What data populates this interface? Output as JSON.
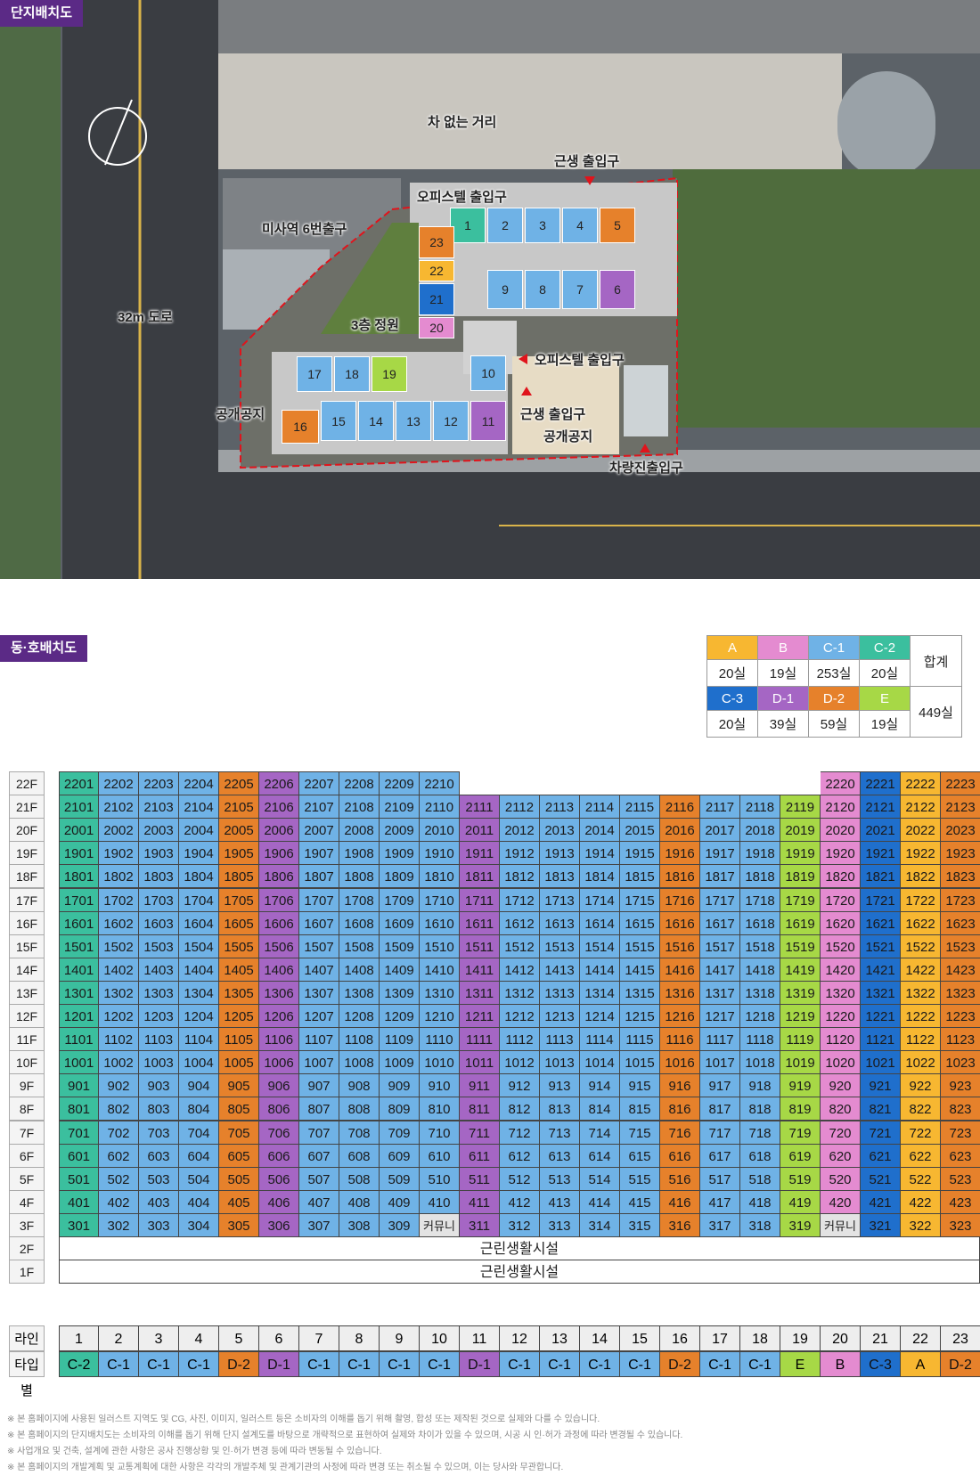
{
  "section1_title": "단지배치도",
  "section2_title": "동·호배치도",
  "map": {
    "street_no_cars": "차 없는 거리",
    "retail_entrance_top": "근생 출입구",
    "officetel_entrance_top": "오피스텔 출입구",
    "misa_exit": "미사역 6번출구",
    "road_32m": "32m 도로",
    "garden_3f": "3층 정원",
    "officetel_entrance_right": "오피스텔 출입구",
    "public_space_left": "공개공지",
    "retail_entrance_bottom": "근생 출입구",
    "public_space_right": "공개공지",
    "vehicle_entrance": "차량진출입구",
    "units": [
      "1",
      "2",
      "3",
      "4",
      "5",
      "6",
      "7",
      "8",
      "9",
      "10",
      "11",
      "12",
      "13",
      "14",
      "15",
      "16",
      "17",
      "18",
      "19",
      "20",
      "21",
      "22",
      "23"
    ]
  },
  "colors": {
    "A": "#f7b731",
    "B": "#e48bd0",
    "C-1": "#6fb2e6",
    "C-2": "#3bbf9e",
    "C-3": "#1f6fcc",
    "D-1": "#a566c4",
    "D-2": "#e6812b",
    "E": "#a7d846"
  },
  "type_stats": {
    "row1_types": [
      "A",
      "B",
      "C-1",
      "C-2"
    ],
    "row1_counts": [
      "20실",
      "19실",
      "253실",
      "20실"
    ],
    "row2_types": [
      "C-3",
      "D-1",
      "D-2",
      "E"
    ],
    "row2_counts": [
      "20실",
      "39실",
      "59실",
      "19실"
    ],
    "total_label": "합계",
    "total_value": "449실"
  },
  "line_types": [
    "C-2",
    "C-1",
    "C-1",
    "C-1",
    "D-2",
    "D-1",
    "C-1",
    "C-1",
    "C-1",
    "C-1",
    "D-1",
    "C-1",
    "C-1",
    "C-1",
    "C-1",
    "D-2",
    "C-1",
    "C-1",
    "E",
    "B",
    "C-3",
    "A",
    "D-2"
  ],
  "floor_labels": [
    "22F",
    "21F",
    "20F",
    "19F",
    "18F",
    "17F",
    "16F",
    "15F",
    "14F",
    "13F",
    "12F",
    "11F",
    "10F",
    "9F",
    "8F",
    "7F",
    "6F",
    "5F",
    "4F",
    "3F",
    "2F",
    "1F"
  ],
  "floor3_overrides": {
    "10": "커뮤니티",
    "20": "커뮤니티"
  },
  "floor22_units": [
    1,
    2,
    3,
    4,
    5,
    6,
    7,
    8,
    9,
    10,
    20,
    21,
    22,
    23
  ],
  "commercial_label": "근린생활시설",
  "line_header": "라인별",
  "type_header": "타입별",
  "line_numbers": [
    "1",
    "2",
    "3",
    "4",
    "5",
    "6",
    "7",
    "8",
    "9",
    "10",
    "11",
    "12",
    "13",
    "14",
    "15",
    "16",
    "17",
    "18",
    "19",
    "20",
    "21",
    "22",
    "23"
  ],
  "notes": [
    "※ 본 홈페이지에 사용된 일러스트 지역도 및 CG, 사진, 이미지, 일러스트 등은 소비자의 이해를 돕기 위해 촬영, 합성 또는 제작된 것으로 실제와 다를 수 있습니다.",
    "※ 본 홈페이지의 단지배치도는 소비자의 이해를 돕기 위해 단지 설계도를 바탕으로 개략적으로 표현하여 실제와 차이가 있을 수 있으며, 시공 시 인·허가 과정에 따라 변경될 수 있습니다.",
    "※ 사업개요 및 건축, 설계에 관한 사항은 공사 진행상황 및 인·허가 변경 등에 따라 변동될 수 있습니다.",
    "※ 본 홈페이지의 개발계획 및 교통계획에 대한 사항은 각각의 개발주체 및 관계기관의 사정에 따라 변경 또는 취소될 수 있으며, 이는 당사와 무관합니다."
  ]
}
